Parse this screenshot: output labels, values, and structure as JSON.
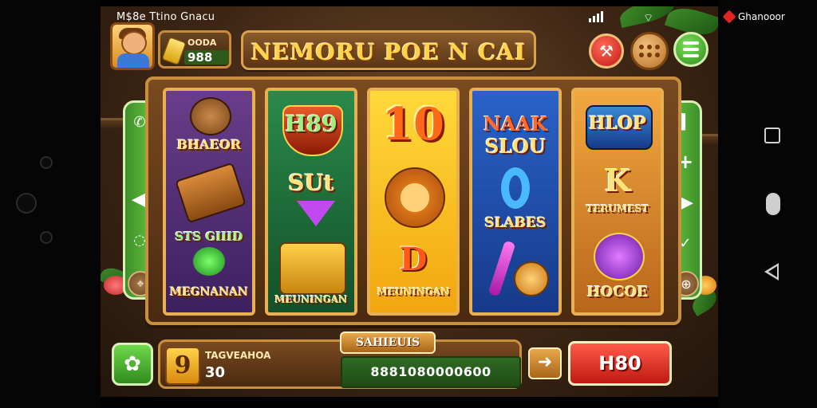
{
  "status_bar": {
    "left_text": "M$8e Ttino Gnacu"
  },
  "brand": {
    "label": "Ghanooor"
  },
  "coins": {
    "label": "OODA",
    "value": "988"
  },
  "title": "NEMORU POE N CAI",
  "reels": [
    {
      "top": "BHAEOR",
      "middle": "",
      "bottom_a": "STS GIIID",
      "bottom_b": "MEGNANAN"
    },
    {
      "top": "H89",
      "middle": "SUt",
      "bottom_a": "",
      "bottom_b": "MEUNINGAN"
    },
    {
      "top": "10",
      "middle": "",
      "bottom_a": "D",
      "bottom_b": "MEUNINGAN"
    },
    {
      "top": "NAAK",
      "top_b": "SLOU",
      "middle": "SLABES",
      "bottom_a": "",
      "bottom_b": ""
    },
    {
      "top": "HLOP",
      "middle": "K",
      "middle_b": "TERUMEST",
      "bottom_a": "",
      "bottom_b": "HOCOE"
    }
  ],
  "bet": {
    "label": "TAGVEAHOA",
    "icon_value": "9",
    "value": "30"
  },
  "info_tab": "SAHIEUIS",
  "win_value": "8881080000600",
  "spin_label": "H80",
  "icons": {
    "tools": "hammer-icon",
    "dots": "grid-dots-icon",
    "menu": "hamburger-icon",
    "plus": "clover-icon",
    "arrow": "arrow-right-icon"
  },
  "colors": {
    "title": "#ffd24a",
    "spin": "#d8261a",
    "menu": "#3f9f2a"
  }
}
